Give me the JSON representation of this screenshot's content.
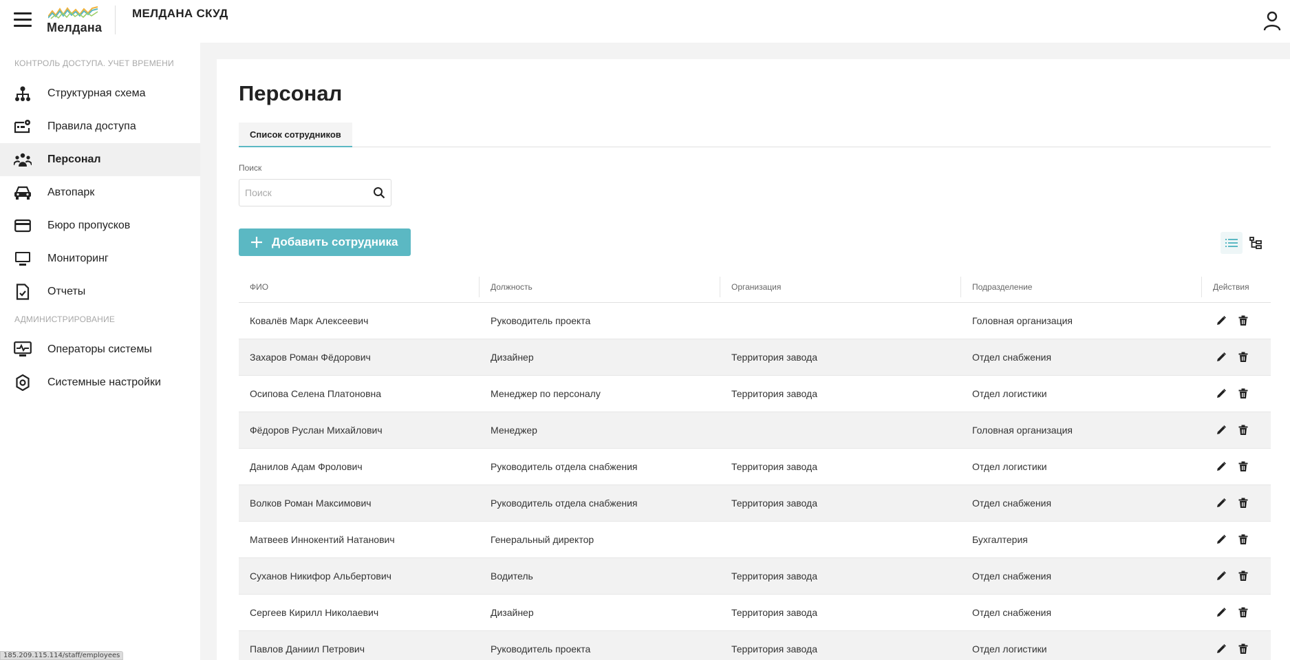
{
  "header": {
    "logo_text": "Мелдана",
    "app_title": "МЕЛДАНА СКУД",
    "colors": {
      "logo_wave_1": "#f0b23a",
      "logo_wave_2": "#5bb8c3",
      "logo_wave_3": "#9ccf6a"
    }
  },
  "sidebar": {
    "section_access": "КОНТРОЛЬ ДОСТУПА. УЧЕТ ВРЕМЕНИ",
    "section_admin": "АДМИНИСТРИРОВАНИЕ",
    "items": [
      {
        "label": "Структурная схема",
        "icon": "org-structure-icon"
      },
      {
        "label": "Правила доступа",
        "icon": "access-rules-icon"
      },
      {
        "label": "Персонал",
        "icon": "people-icon",
        "active": true
      },
      {
        "label": "Автопарк",
        "icon": "car-icon"
      },
      {
        "label": "Бюро пропусков",
        "icon": "card-icon"
      },
      {
        "label": "Мониторинг",
        "icon": "monitor-icon"
      },
      {
        "label": "Отчеты",
        "icon": "report-icon"
      },
      {
        "label": "Операторы системы",
        "icon": "operators-icon"
      },
      {
        "label": "Системные настройки",
        "icon": "gear-icon"
      }
    ]
  },
  "main": {
    "title": "Персонал",
    "tab_label": "Список сотрудников",
    "search_label": "Поиск",
    "search_placeholder": "Поиск",
    "search_value": "",
    "add_button_label": "Добавить сотрудника",
    "accent_color": "#5bb8c3"
  },
  "table": {
    "columns": [
      "ФИО",
      "Должность",
      "Организация",
      "Подразделение",
      "Действия"
    ],
    "rows": [
      [
        "Ковалёв Марк Алексеевич",
        "Руководитель проекта",
        "",
        "Головная организация"
      ],
      [
        "Захаров Роман Фёдорович",
        "Дизайнер",
        "Территория завода",
        "Отдел снабжения"
      ],
      [
        "Осипова Селена Платоновна",
        "Менеджер по персоналу",
        "Территория завода",
        "Отдел логистики"
      ],
      [
        "Фёдоров Руслан Михайлович",
        "Менеджер",
        "",
        "Головная организация"
      ],
      [
        "Данилов Адам Фролович",
        "Руководитель отдела снабжения",
        "Территория завода",
        "Отдел логистики"
      ],
      [
        "Волков Роман Максимович",
        "Руководитель отдела снабжения",
        "Территория завода",
        "Отдел снабжения"
      ],
      [
        "Матвеев Иннокентий Натанович",
        "Генеральный директор",
        "",
        "Бухгалтерия"
      ],
      [
        "Суханов Никифор Альбертович",
        "Водитель",
        "Территория завода",
        "Отдел снабжения"
      ],
      [
        "Сергеев Кирилл Николаевич",
        "Дизайнер",
        "Территория завода",
        "Отдел снабжения"
      ],
      [
        "Павлов Даниил Петрович",
        "Руководитель проекта",
        "Территория завода",
        "Отдел логистики"
      ]
    ]
  },
  "statusbar": {
    "url": "185.209.115.114/staff/employees"
  }
}
